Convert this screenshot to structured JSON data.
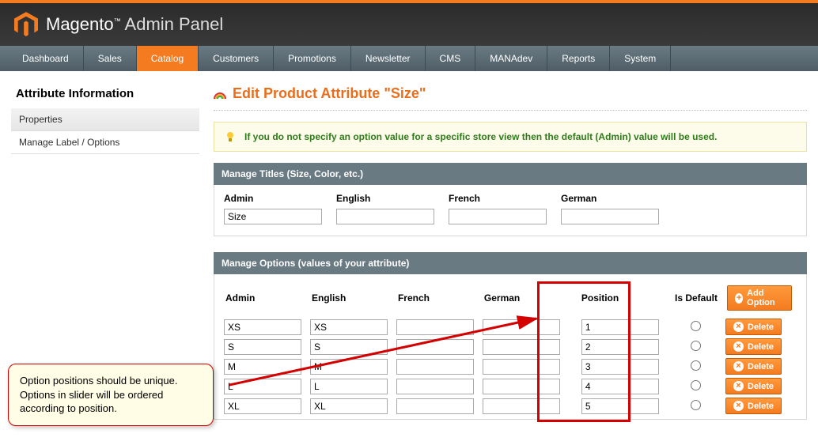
{
  "header": {
    "brand_name": "Magento",
    "brand_suffix": "Admin Panel"
  },
  "nav": {
    "items": [
      "Dashboard",
      "Sales",
      "Catalog",
      "Customers",
      "Promotions",
      "Newsletter",
      "CMS",
      "MANAdev",
      "Reports",
      "System"
    ],
    "active": "Catalog"
  },
  "sidebar": {
    "title": "Attribute Information",
    "items": [
      {
        "label": "Properties",
        "selected": true
      },
      {
        "label": "Manage Label / Options",
        "selected": false
      }
    ]
  },
  "page": {
    "title": "Edit Product Attribute \"Size\"",
    "notice": "If you do not specify an option value for a specific store view then the default (Admin) value will be used."
  },
  "titles_section": {
    "heading": "Manage Titles (Size, Color, etc.)",
    "columns": [
      "Admin",
      "English",
      "French",
      "German"
    ],
    "values": [
      "Size",
      "",
      "",
      ""
    ]
  },
  "options_section": {
    "heading": "Manage Options (values of your attribute)",
    "columns": [
      "Admin",
      "English",
      "French",
      "German",
      "Position",
      "Is Default"
    ],
    "add_button": "Add Option",
    "delete_button": "Delete",
    "rows": [
      {
        "admin": "XS",
        "english": "XS",
        "french": "",
        "german": "",
        "position": "1"
      },
      {
        "admin": "S",
        "english": "S",
        "french": "",
        "german": "",
        "position": "2"
      },
      {
        "admin": "M",
        "english": "M",
        "french": "",
        "german": "",
        "position": "3"
      },
      {
        "admin": "L",
        "english": "L",
        "french": "",
        "german": "",
        "position": "4"
      },
      {
        "admin": "XL",
        "english": "XL",
        "french": "",
        "german": "",
        "position": "5"
      }
    ]
  },
  "callout": "Option positions should be unique. Options in slider will be ordered according to position."
}
